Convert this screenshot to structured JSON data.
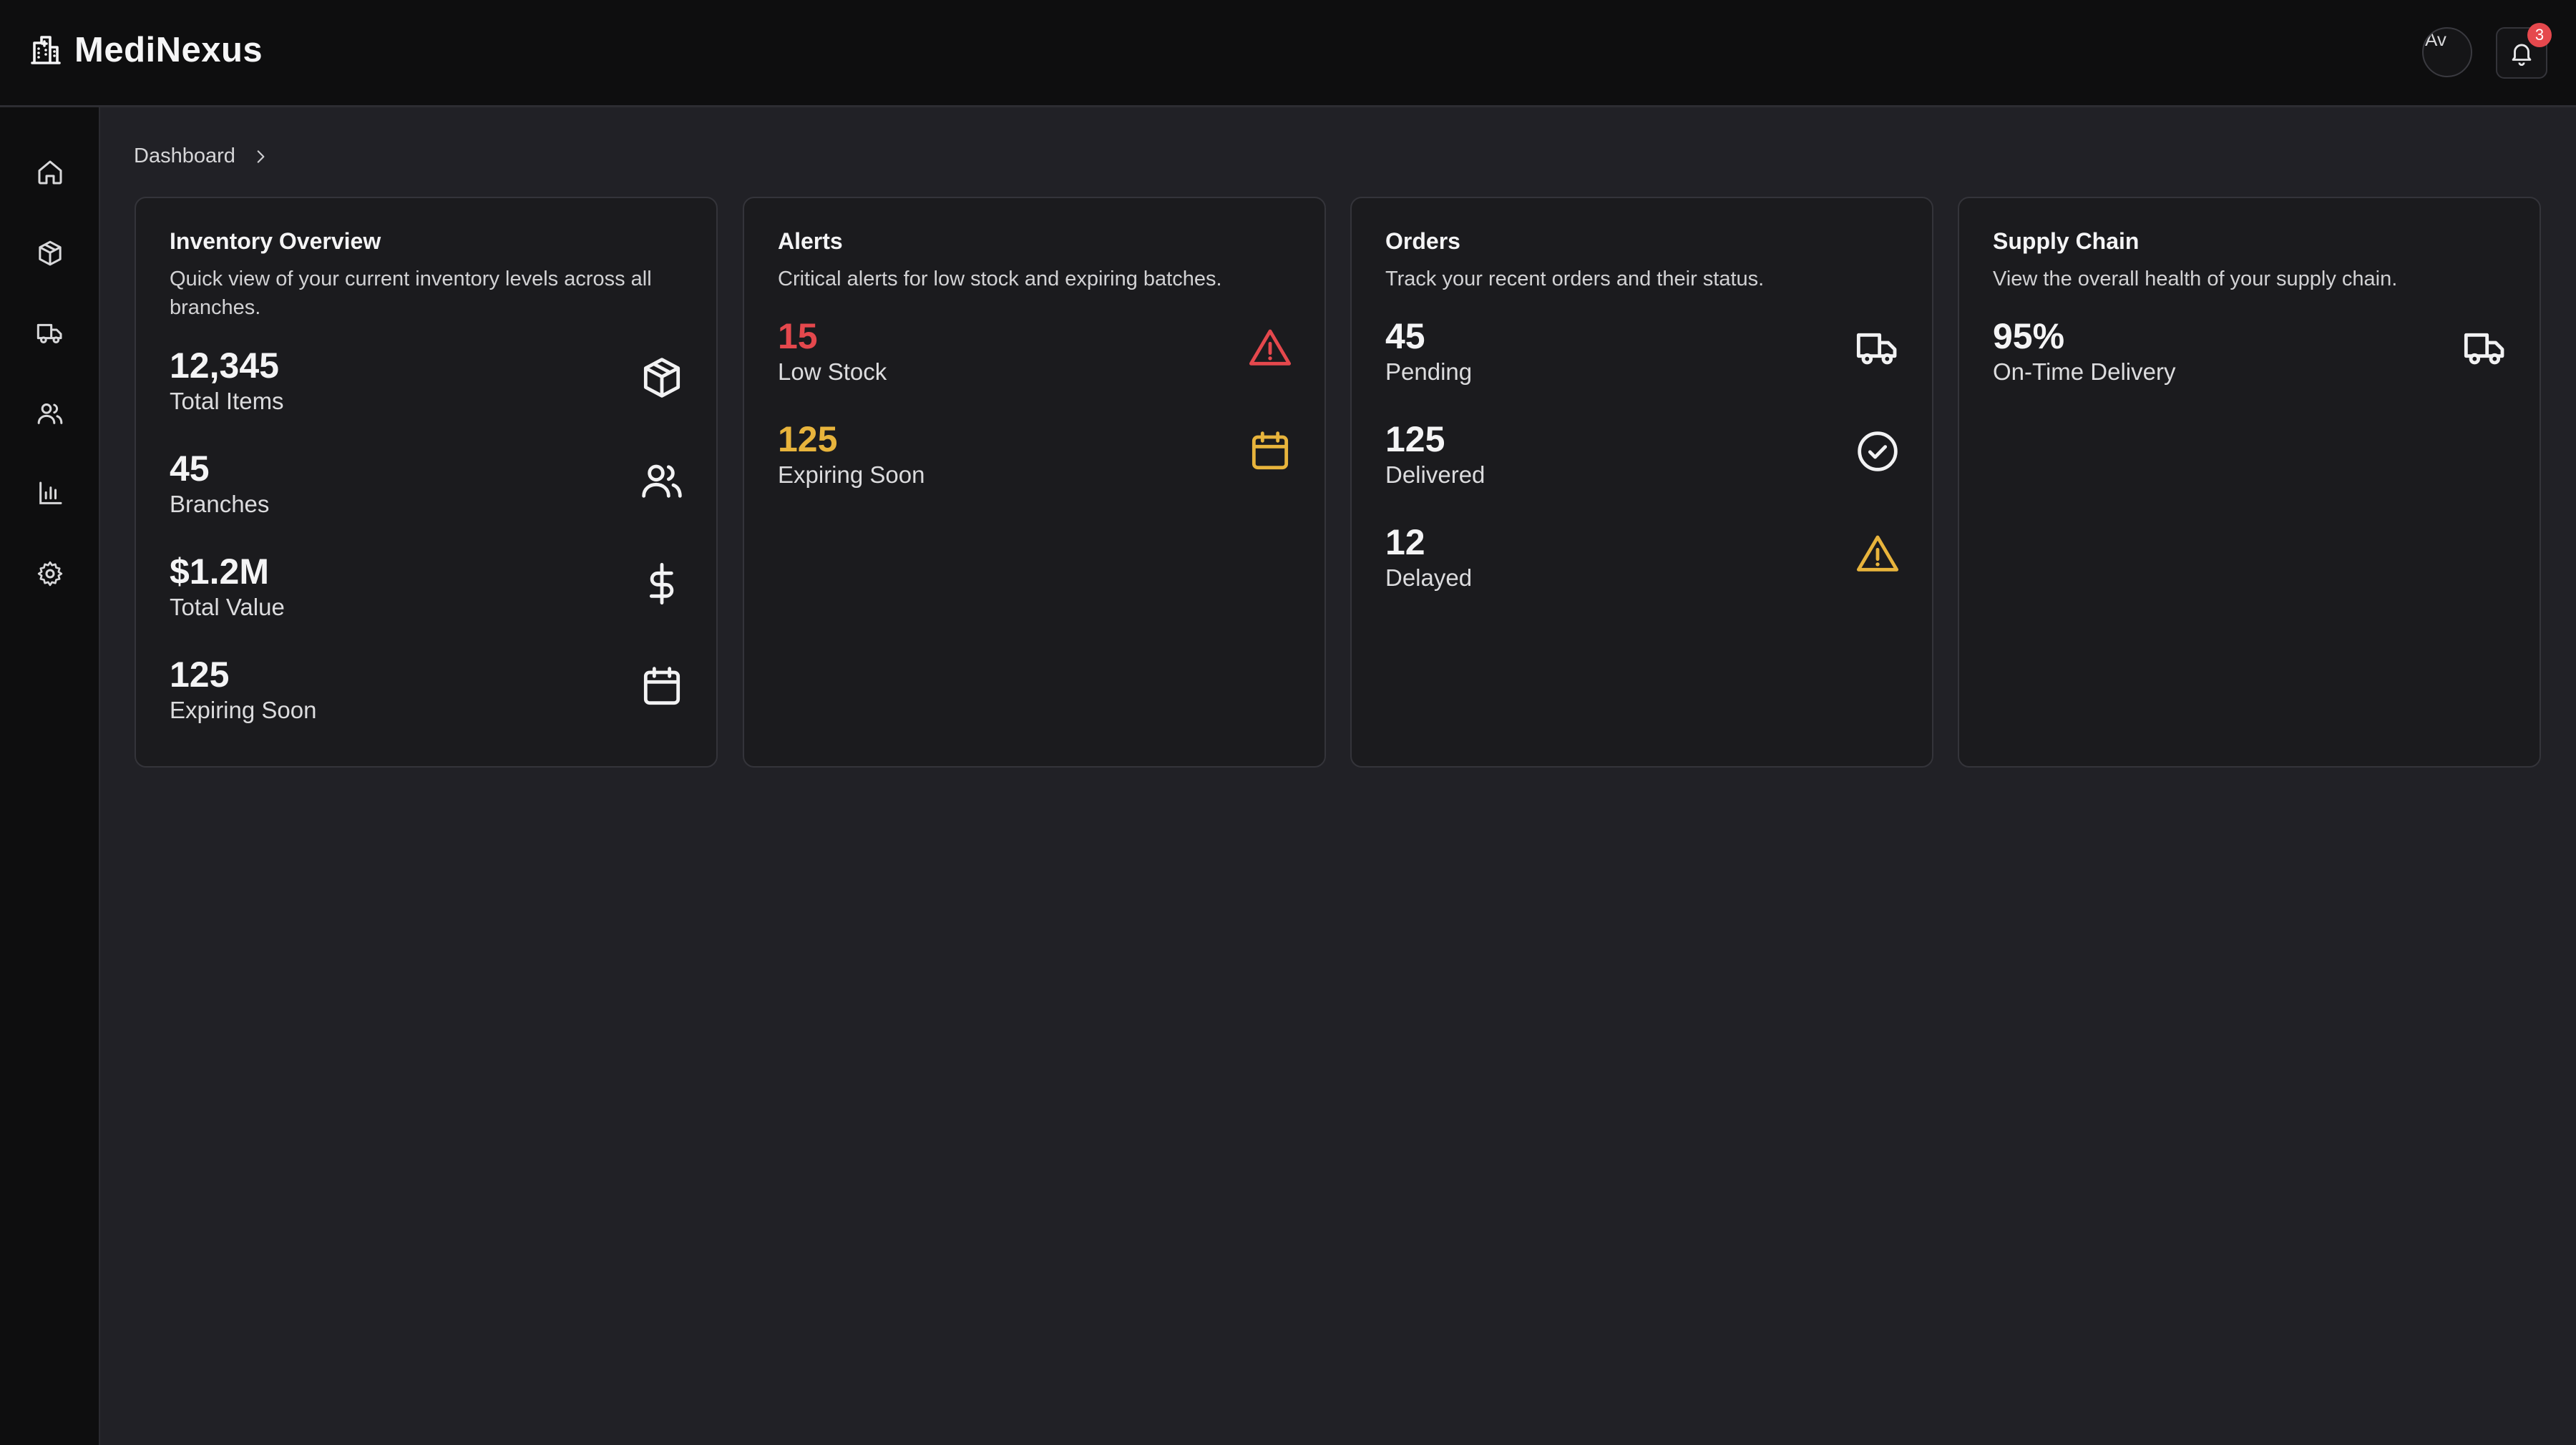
{
  "app": {
    "name": "MediNexus"
  },
  "header": {
    "avatar_alt": "Av",
    "notification_count": "3"
  },
  "sidebar": {
    "items": [
      {
        "name": "home",
        "icon": "home-icon"
      },
      {
        "name": "inventory",
        "icon": "box-icon"
      },
      {
        "name": "orders",
        "icon": "truck-icon"
      },
      {
        "name": "users",
        "icon": "users-icon"
      },
      {
        "name": "reports",
        "icon": "bar-chart-icon"
      },
      {
        "name": "settings",
        "icon": "gear-icon"
      }
    ]
  },
  "breadcrumb": {
    "current": "Dashboard"
  },
  "colors": {
    "danger": "#e5484d",
    "warning": "#e8b43c",
    "text": "#f4f4f5"
  },
  "cards": {
    "inventory": {
      "title": "Inventory Overview",
      "description": "Quick view of your current inventory levels across all branches.",
      "stats": [
        {
          "value": "12,345",
          "label": "Total Items",
          "icon": "box-icon"
        },
        {
          "value": "45",
          "label": "Branches",
          "icon": "users-icon"
        },
        {
          "value": "$1.2M",
          "label": "Total Value",
          "icon": "dollar-icon"
        },
        {
          "value": "125",
          "label": "Expiring Soon",
          "icon": "calendar-icon"
        }
      ]
    },
    "alerts": {
      "title": "Alerts",
      "description": "Critical alerts for low stock and expiring batches.",
      "stats": [
        {
          "value": "15",
          "label": "Low Stock",
          "icon": "alert-triangle-icon"
        },
        {
          "value": "125",
          "label": "Expiring Soon",
          "icon": "calendar-icon"
        }
      ]
    },
    "orders": {
      "title": "Orders",
      "description": "Track your recent orders and their status.",
      "stats": [
        {
          "value": "45",
          "label": "Pending",
          "icon": "truck-icon"
        },
        {
          "value": "125",
          "label": "Delivered",
          "icon": "check-circle-icon"
        },
        {
          "value": "12",
          "label": "Delayed",
          "icon": "alert-triangle-icon"
        }
      ]
    },
    "supply": {
      "title": "Supply Chain",
      "description": "View the overall health of your supply chain.",
      "stats": [
        {
          "value": "95%",
          "label": "On-Time Delivery",
          "icon": "truck-icon"
        }
      ]
    }
  }
}
